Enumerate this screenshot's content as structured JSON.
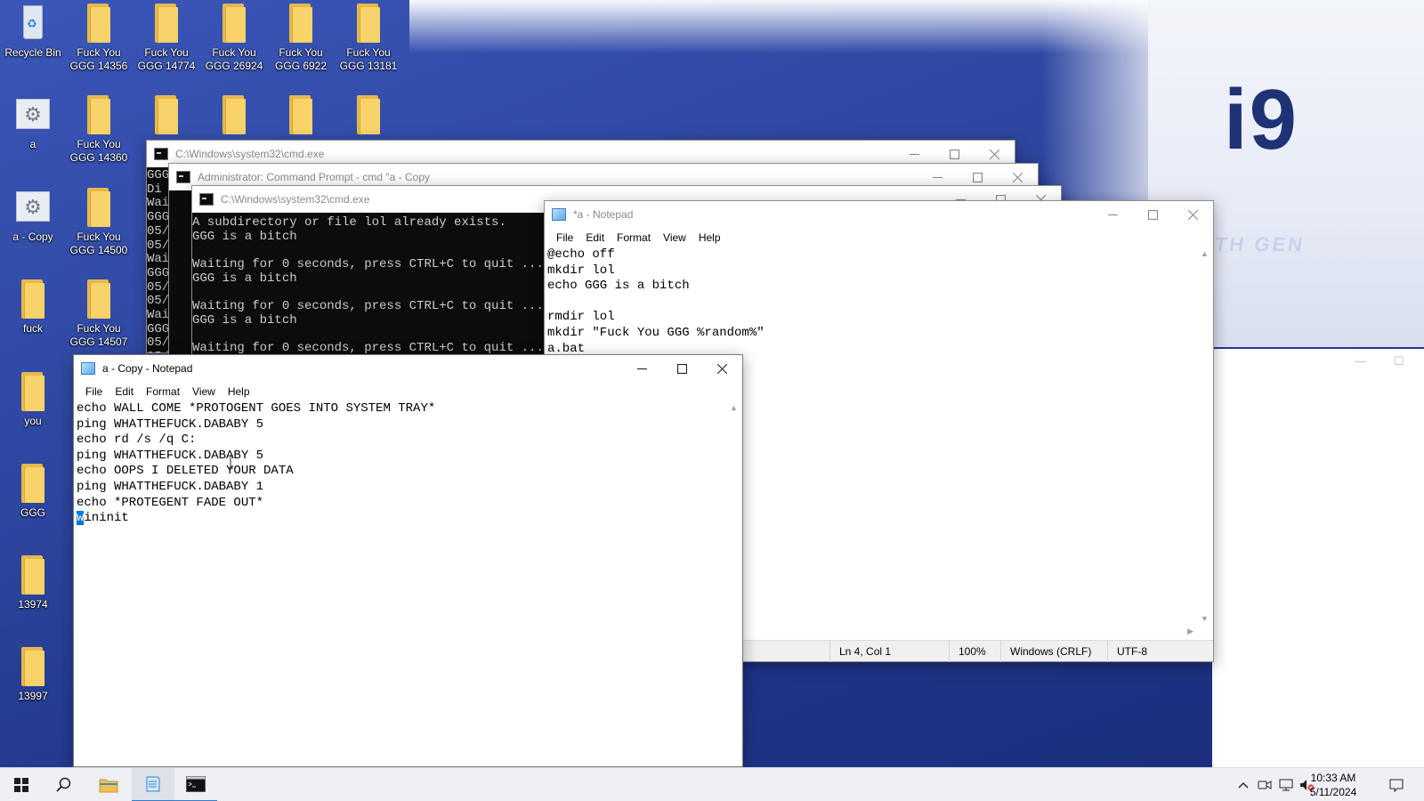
{
  "desktop": {
    "wallpaper": {
      "brand_text": "i9",
      "subtitle_text": "TH GEN"
    },
    "icons": [
      {
        "label": "Recycle Bin",
        "icon": "recycle-bin-icon"
      },
      {
        "label": "Fuck You GGG 14356",
        "icon": "folder-icon"
      },
      {
        "label": "Fuck You GGG 14774",
        "icon": "folder-icon"
      },
      {
        "label": "Fuck You GGG 26924",
        "icon": "folder-icon"
      },
      {
        "label": "Fuck You GGG 6922",
        "icon": "folder-icon"
      },
      {
        "label": "Fuck You GGG 13181",
        "icon": "folder-icon"
      },
      {
        "label": "a",
        "icon": "batch-file-icon"
      },
      {
        "label": "Fuck You GGG 14360",
        "icon": "folder-icon"
      },
      {
        "label": "",
        "icon": "folder-icon"
      },
      {
        "label": "",
        "icon": "folder-icon"
      },
      {
        "label": "",
        "icon": "folder-icon"
      },
      {
        "label": "",
        "icon": "folder-icon"
      },
      {
        "label": "a - Copy",
        "icon": "batch-file-icon"
      },
      {
        "label": "Fuck You GGG 14500",
        "icon": "folder-icon"
      },
      {
        "label": "fuck",
        "icon": "folder-icon"
      },
      {
        "label": "Fuck You GGG 14507",
        "icon": "folder-icon"
      },
      {
        "label": "you",
        "icon": "folder-icon"
      },
      {
        "label": "GGG",
        "icon": "folder-icon"
      },
      {
        "label": "13974",
        "icon": "folder-icon"
      },
      {
        "label": "13997",
        "icon": "folder-icon"
      }
    ]
  },
  "cmd_window_1": {
    "title": "C:\\Windows\\system32\\cmd.exe",
    "visible_text": "GGG\nDi\nWai\nGGG\n05/\n05/\nWai\nGGG\n05/\n05/\nWai\nGGG\n05/\n05/\nWai\nGGG"
  },
  "cmd_window_2": {
    "title": "Administrator: Command Prompt - cmd  \"a - Copy"
  },
  "cmd_window_3": {
    "title": "C:\\Windows\\system32\\cmd.exe",
    "output": "A subdirectory or file lol already exists.\nGGG is a bitch\n\nWaiting for 0 seconds, press CTRL+C to quit ...\nGGG is a bitch\n\nWaiting for 0 seconds, press CTRL+C to quit ...\nGGG is a bitch\n\nWaiting for 0 seconds, press CTRL+C to quit ..."
  },
  "notepad_a": {
    "title": "*a - Notepad",
    "menu": [
      "File",
      "Edit",
      "Format",
      "View",
      "Help"
    ],
    "content": "@echo off\nmkdir lol\necho GGG is a bitch\n\nrmdir lol\nmkdir \"Fuck You GGG %random%\"\na.bat",
    "status": {
      "position": "Ln 4, Col 1",
      "zoom": "100%",
      "line_ending": "Windows (CRLF)",
      "encoding": "UTF-8"
    }
  },
  "notepad_copy": {
    "title": "a - Copy - Notepad",
    "menu": [
      "File",
      "Edit",
      "Format",
      "View",
      "Help"
    ],
    "content": "echo WALL COME *PROTOGENT GOES INTO SYSTEM TRAY*\nping WHATTHEFUCK.DABABY 5\necho rd /s /q C:\nping WHATTHEFUCK.DABABY 5\necho OOPS I DELETED YOUR DATA\nping WHATTHEFUCK.DABABY 1\necho *PROTEGENT FADE OUT*\n",
    "selected_char": "w",
    "last_line_rest": "ininit"
  },
  "taskbar": {
    "clock_time": "10:33 AM",
    "clock_date": "5/11/2024",
    "buttons": [
      "start-icon",
      "search-icon",
      "file-explorer-icon",
      "notepad-icon",
      "command-prompt-icon"
    ],
    "tray": [
      "chevron-up-icon",
      "meet-now-icon",
      "network-icon",
      "volume-muted-icon",
      "notifications-icon"
    ]
  }
}
